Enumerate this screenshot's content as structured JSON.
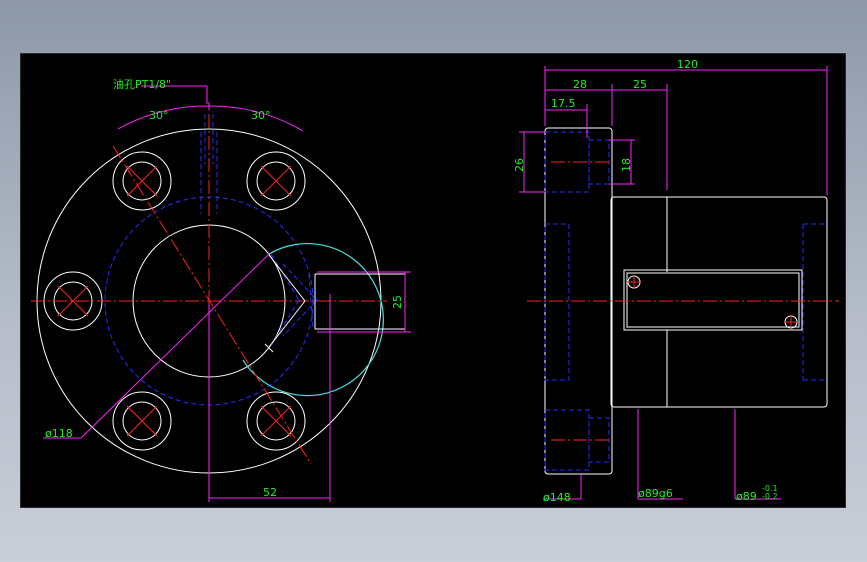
{
  "drawing": {
    "colors": {
      "background": "#000000",
      "outline": "#ffffff",
      "hidden": "#2a2aff",
      "center": "#ff2222",
      "dimension_line": "#ff22ff",
      "dimension_text": "#22ee22"
    },
    "front_view": {
      "note": "油孔PT1/8\"",
      "angle_left": "30°",
      "angle_right": "30°",
      "dia_pitch": "ø118",
      "dim_horizontal": "52",
      "dim_vertical": "25"
    },
    "side_view": {
      "overall_length": "120",
      "flange_len": "28",
      "body_len": "25",
      "counterbore_depth": "17.5",
      "flange_h": "26",
      "counterbore_h": "18",
      "dia_flange": "ø148",
      "dia_body": "ø89g6",
      "dia_tol_base": "ø89",
      "dia_tol_upper": "-0.1",
      "dia_tol_lower": "-0.2"
    }
  }
}
